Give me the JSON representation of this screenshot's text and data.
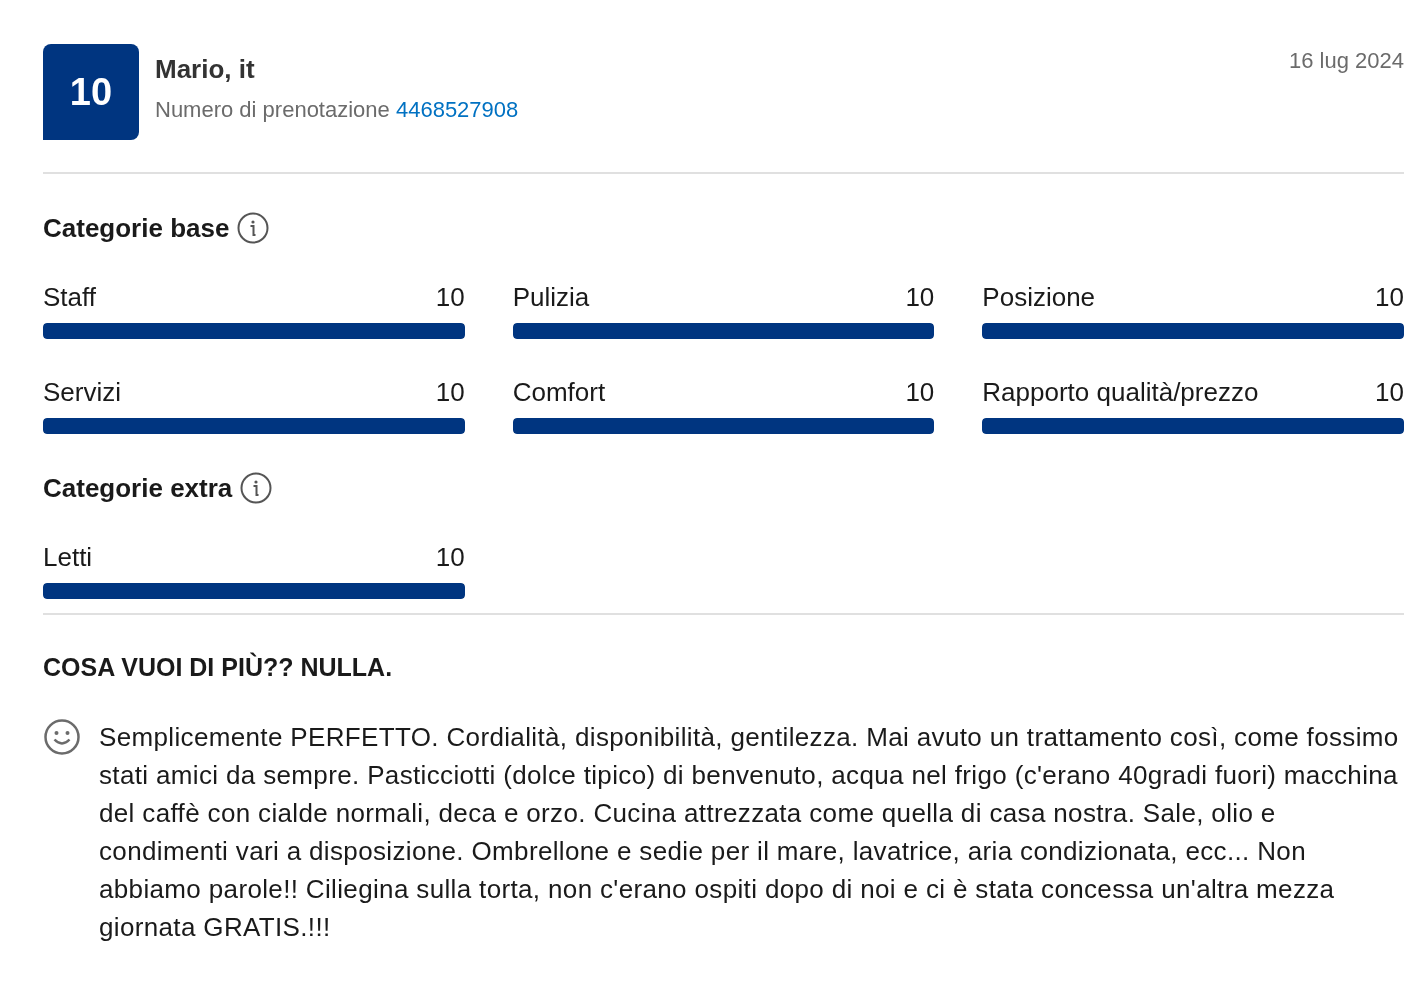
{
  "review": {
    "score": "10",
    "name": "Mario, it",
    "booking_label": "Numero di prenotazione",
    "booking_number": "4468527908",
    "date": "16 lug 2024"
  },
  "sections": [
    {
      "title": "Categorie base",
      "categories": [
        {
          "label": "Staff",
          "score": "10",
          "level": 1
        },
        {
          "label": "Pulizia",
          "score": "10",
          "level": 1
        },
        {
          "label": "Posizione",
          "score": "10",
          "level": 1
        },
        {
          "label": "Servizi",
          "score": "10",
          "level": 1
        },
        {
          "label": "Comfort",
          "score": "10",
          "level": 1
        },
        {
          "label": "Rapporto qualità/prezzo",
          "score": "10",
          "level": 1
        }
      ]
    },
    {
      "title": "Categorie extra",
      "categories": [
        {
          "label": "Letti",
          "score": "10",
          "level": 1
        }
      ]
    }
  ],
  "headline": "COSA VUOI DI PIÙ?? NULLA.",
  "comment": "Semplicemente PERFETTO. Cordialità, disponibilità, gentilezza. Mai avuto un trattamento così, come fossimo stati amici da sempre. Pasticciotti (dolce tipico) di benvenuto, acqua nel frigo (c'erano 40gradi fuori) macchina del caffè con cialde normali, deca e orzo. Cucina attrezzata come quella di casa nostra. Sale, olio e condimenti vari a disposizione. Ombrellone e sedie per il mare, lavatrice, aria condizionata, ecc... Non abbiamo parole!! Ciliegina sulla torta, non c'erano ospiti dopo di noi e ci è stata concessa un'altra mezza giornata GRATIS.!!!"
}
